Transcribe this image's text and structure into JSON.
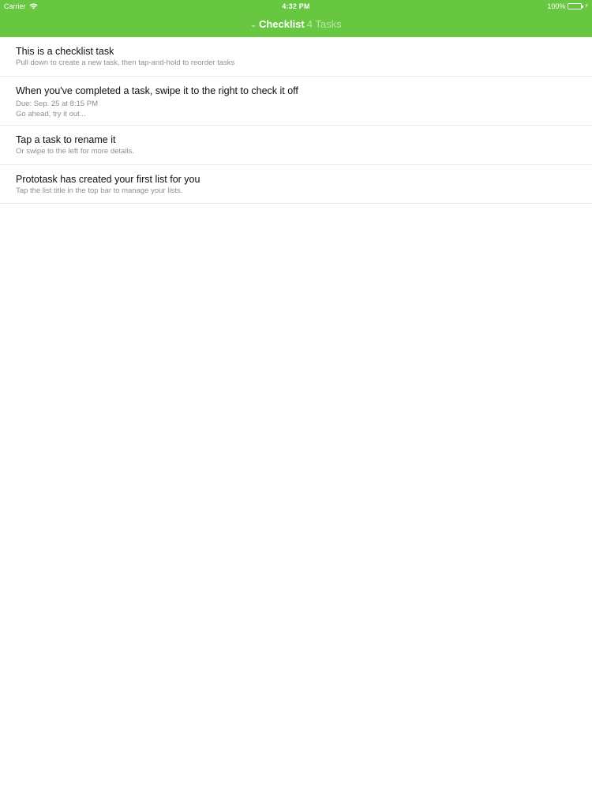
{
  "status_bar": {
    "carrier": "Carrier",
    "time": "4:32 PM",
    "battery": "100%",
    "wifi_icon": "wifi-icon",
    "battery_icon": "battery-icon",
    "charging_icon": "lightning-icon"
  },
  "nav": {
    "chevron_icon": "chevron-down-icon",
    "chevron_glyph": "⌄",
    "list_title": "Checklist",
    "task_count": "4 Tasks",
    "bar_color": "#67c741"
  },
  "tasks": [
    {
      "title": "This is a checklist task",
      "note": "Pull down to create a new task, then tap-and-hold to reorder tasks"
    },
    {
      "title": "When you've completed a task, swipe it to the right to check it off",
      "due": "Due: Sep. 25 at 8:15 PM",
      "note": "Go ahead, try it out..."
    },
    {
      "title": "Tap a task to rename it",
      "note": "Or swipe to the left for more details."
    },
    {
      "title": "Prototask has created your first list for you",
      "note": "Tap the list title in the top bar to manage your lists."
    }
  ]
}
